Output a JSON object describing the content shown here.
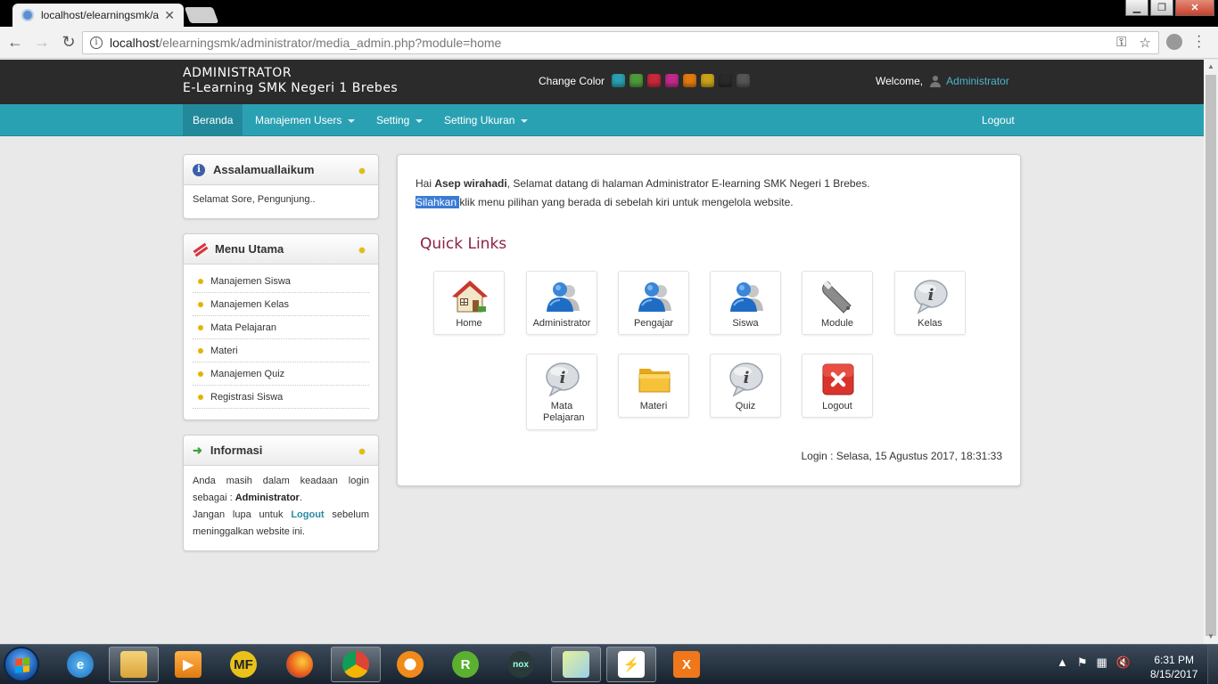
{
  "browser": {
    "tab_title": "localhost/elearningsmk/a",
    "tab_close": "✕",
    "url_host": "localhost",
    "url_path": "/elearningsmk/administrator/media_admin.php?module=home"
  },
  "header": {
    "brand_line1": "ADMINISTRATOR",
    "brand_line2": "E-Learning SMK Negeri 1 Brebes",
    "change_color_label": "Change Color",
    "swatches": [
      "#2a9fb0",
      "#4e9a3a",
      "#c8283a",
      "#c02a8a",
      "#e07a10",
      "#c9a21a",
      "#2a2a2a",
      "#555555"
    ],
    "welcome_label": "Welcome,",
    "user_name": "Administrator"
  },
  "nav": {
    "items": [
      {
        "label": "Beranda"
      },
      {
        "label": "Manajemen Users"
      },
      {
        "label": "Setting"
      },
      {
        "label": "Setting Ukuran"
      }
    ],
    "logout": "Logout",
    "active_color": "#22899a",
    "bar_color": "#2aa1b3"
  },
  "sidebar": {
    "greeting": {
      "title": "Assalamuallaikum",
      "text": "Selamat Sore, Pengunjung.."
    },
    "menu": {
      "title": "Menu Utama",
      "items": [
        "Manajemen Siswa",
        "Manajemen Kelas",
        "Mata Pelajaran",
        "Materi",
        "Manajemen Quiz",
        "Registrasi Siswa"
      ]
    },
    "info": {
      "title": "Informasi",
      "line1_pre": "Anda masih dalam keadaan login sebagai : ",
      "line1_bold": "Administrator",
      "line1_post": ".",
      "line2_pre": "Jangan lupa untuk ",
      "line2_link": "Logout",
      "line2_post": " sebelum meninggalkan website ini."
    }
  },
  "main": {
    "greet_pre": "Hai ",
    "greet_name": "Asep wirahadi",
    "greet_post": ", Selamat datang di halaman Administrator E-learning SMK Negeri 1 Brebes.",
    "line2_selected": "Silahkan ",
    "line2_rest": "klik menu pilihan yang berada di sebelah kiri untuk mengelola website.",
    "quick_links_title": "Quick Links",
    "quick_links": [
      {
        "label": "Home",
        "icon": "home-icon"
      },
      {
        "label": "Administrator",
        "icon": "users-icon"
      },
      {
        "label": "Pengajar",
        "icon": "users-icon"
      },
      {
        "label": "Siswa",
        "icon": "users-icon"
      },
      {
        "label": "Module",
        "icon": "wrench-icon"
      },
      {
        "label": "Kelas",
        "icon": "info-bubble-icon"
      },
      {
        "label": "Mata Pelajaran",
        "icon": "info-bubble-icon"
      },
      {
        "label": "Materi",
        "icon": "folder-icon"
      },
      {
        "label": "Quiz",
        "icon": "info-bubble-icon"
      },
      {
        "label": "Logout",
        "icon": "close-box-icon"
      }
    ],
    "login_info": "Login : Selasa, 15 Agustus 2017, 18:31:33"
  },
  "taskbar": {
    "apps": [
      {
        "name": "internet-explorer",
        "glyph": "e"
      },
      {
        "name": "file-explorer",
        "glyph": ""
      },
      {
        "name": "media-player",
        "glyph": "▶"
      },
      {
        "name": "mf-app",
        "glyph": "MF"
      },
      {
        "name": "firefox",
        "glyph": ""
      },
      {
        "name": "chrome",
        "glyph": ""
      },
      {
        "name": "vpn-app",
        "glyph": ""
      },
      {
        "name": "r-app",
        "glyph": "R"
      },
      {
        "name": "nox",
        "glyph": "nox"
      },
      {
        "name": "notes-app",
        "glyph": ""
      },
      {
        "name": "filezilla",
        "glyph": "⚡"
      },
      {
        "name": "xampp",
        "glyph": "X"
      }
    ],
    "time": "6:31 PM",
    "date": "8/15/2017"
  }
}
